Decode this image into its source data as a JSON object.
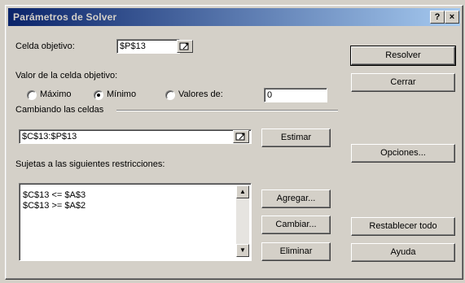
{
  "window": {
    "title": "Parámetros de Solver",
    "help_btn": "?",
    "close_btn": "×"
  },
  "target_cell": {
    "label": "Celda objetivo:",
    "value": "$P$13"
  },
  "value_of": {
    "label": "Valor de la celda objetivo:",
    "options": [
      {
        "label": "Máximo",
        "checked": false
      },
      {
        "label": "Mínimo",
        "checked": true
      },
      {
        "label": "Valores de:",
        "checked": false
      }
    ],
    "value_input": "0"
  },
  "changing": {
    "label": "Cambiando las celdas",
    "value": "$C$13:$P$13"
  },
  "constraints": {
    "label": "Sujetas a las siguientes restricciones:",
    "items": [
      "$C$13 <= $A$3",
      "$C$13 >= $A$2"
    ]
  },
  "buttons": {
    "estimate": "Estimar",
    "add": "Agregar...",
    "change": "Cambiar...",
    "delete": "Eliminar",
    "solve": "Resolver",
    "close": "Cerrar",
    "options": "Opciones...",
    "reset": "Restablecer todo",
    "help": "Ayuda"
  },
  "icons": {
    "ref": "range-select-icon",
    "scroll_up": "scroll-up-arrow-icon",
    "scroll_down": "scroll-down-arrow-icon"
  }
}
